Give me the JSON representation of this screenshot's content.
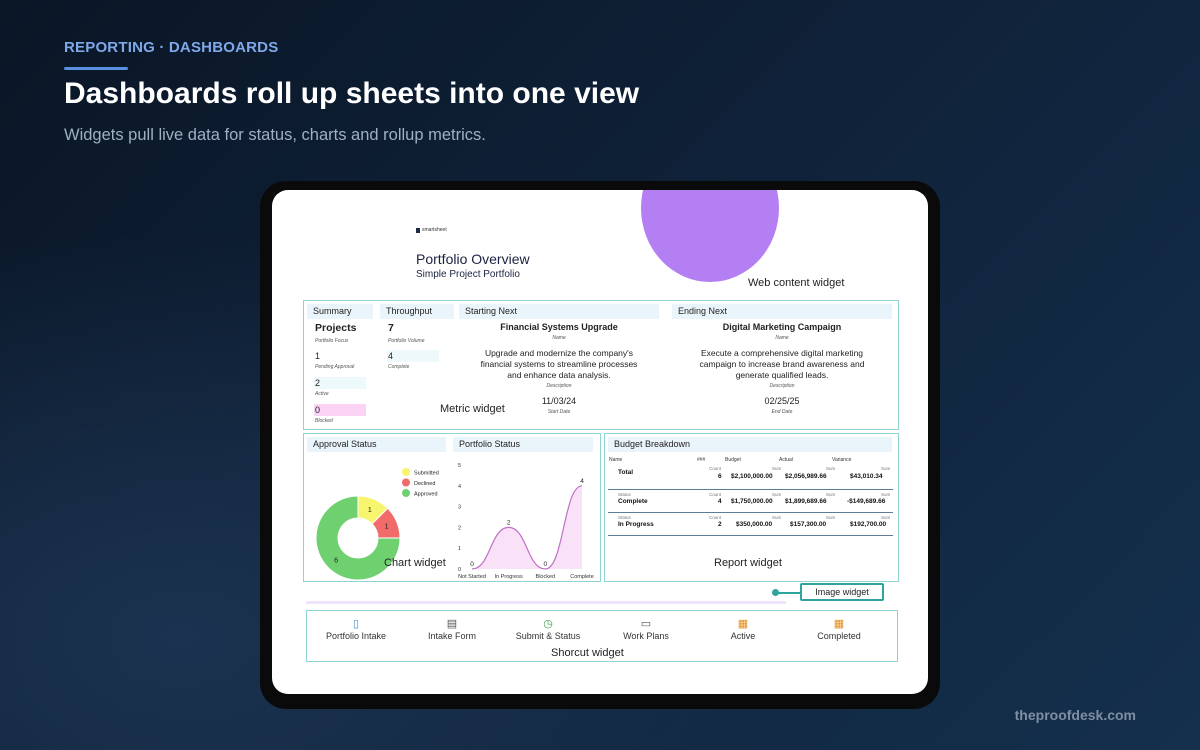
{
  "page": {
    "eyebrow": "REPORTING · DASHBOARDS",
    "title": "Dashboards roll up sheets into one view",
    "subtitle": "Widgets pull live data for status, charts and rollup metrics.",
    "credit": "theproofdesk.com"
  },
  "dashboard": {
    "brand": "smartsheet",
    "title": "Portfolio Overview",
    "subtitle": "Simple Project Portfolio",
    "labels": {
      "web_content": "Web content widget",
      "metric": "Metric widget",
      "chart": "Chart widget",
      "report": "Report widget",
      "image": "Image widget",
      "shortcut": "Shorcut widget"
    },
    "summary": {
      "header": "Summary",
      "focus_value": "Projects",
      "focus_label": "Portfolio Focus",
      "pending_value": "1",
      "pending_label": "Pending Approval",
      "active_value": "2",
      "active_label": "Active",
      "blocked_value": "0",
      "blocked_label": "Blocked"
    },
    "throughput": {
      "header": "Throughput",
      "volume_value": "7",
      "volume_label": "Portfolio Volume",
      "complete_value": "4",
      "complete_label": "Complete"
    },
    "starting_next": {
      "header": "Starting Next",
      "name": "Financial Systems Upgrade",
      "name_label": "Name",
      "description": [
        "Upgrade and modernize the company's",
        "financial systems to streamline processes",
        "and enhance data analysis."
      ],
      "description_label": "Description",
      "date": "11/03/24",
      "date_label": "Start Date"
    },
    "ending_next": {
      "header": "Ending Next",
      "name": "Digital Marketing Campaign",
      "name_label": "Name",
      "description": [
        "Execute a comprehensive digital marketing",
        "campaign to increase brand awareness and",
        "generate qualified leads."
      ],
      "description_label": "Description",
      "date": "02/25/25",
      "date_label": "End Date"
    },
    "approval": {
      "header": "Approval Status",
      "legend": [
        {
          "label": "Submitted",
          "color": "#f7f56e"
        },
        {
          "label": "Declined",
          "color": "#f26b6b"
        },
        {
          "label": "Approved",
          "color": "#6fd06f"
        }
      ]
    },
    "portfolio_status": {
      "header": "Portfolio Status"
    },
    "budget": {
      "header": "Budget Breakdown",
      "columns": [
        "Name",
        "###",
        "Budget",
        "Actual",
        "Variance"
      ],
      "count_label": "Count",
      "sum_label": "Sum",
      "status_label": "Status",
      "rows": [
        {
          "name": "Total",
          "count": "6",
          "budget": "$2,100,000.00",
          "actual": "$2,056,989.66",
          "variance": "$43,010.34"
        },
        {
          "name": "Complete",
          "count": "4",
          "budget": "$1,750,000.00",
          "actual": "$1,899,689.66",
          "variance": "-$149,689.66"
        },
        {
          "name": "In Progress",
          "count": "2",
          "budget": "$350,000.00",
          "actual": "$157,300.00",
          "variance": "$192,700.00"
        }
      ]
    },
    "shortcuts": [
      {
        "label": "Portfolio Intake",
        "icon": "document-icon",
        "glyph": "▯",
        "color": "#3a8fd6"
      },
      {
        "label": "Intake Form",
        "icon": "form-icon",
        "glyph": "▤",
        "color": "#555555"
      },
      {
        "label": "Submit & Status",
        "icon": "clock-icon",
        "glyph": "◷",
        "color": "#3aa04a"
      },
      {
        "label": "Work Plans",
        "icon": "folder-icon",
        "glyph": "▭",
        "color": "#555555"
      },
      {
        "label": "Active",
        "icon": "sheet-icon",
        "glyph": "▦",
        "color": "#e08a1e"
      },
      {
        "label": "Completed",
        "icon": "sheet-icon",
        "glyph": "▦",
        "color": "#e08a1e"
      }
    ]
  },
  "chart_data": [
    {
      "type": "pie",
      "categories": [
        "Submitted",
        "Declined",
        "Approved"
      ],
      "values": [
        1,
        1,
        6
      ],
      "colors": [
        "#f7f56e",
        "#f26b6b",
        "#6fd06f"
      ],
      "legend": "top-right"
    },
    {
      "type": "area",
      "categories": [
        "Not Started",
        "In Progress",
        "Blocked",
        "Complete"
      ],
      "values": [
        0,
        2,
        0,
        4
      ],
      "ylim": [
        0,
        5
      ],
      "yticks": [
        "0",
        "1",
        "2",
        "3",
        "4",
        "5"
      ],
      "color": "#c06fc8"
    }
  ]
}
